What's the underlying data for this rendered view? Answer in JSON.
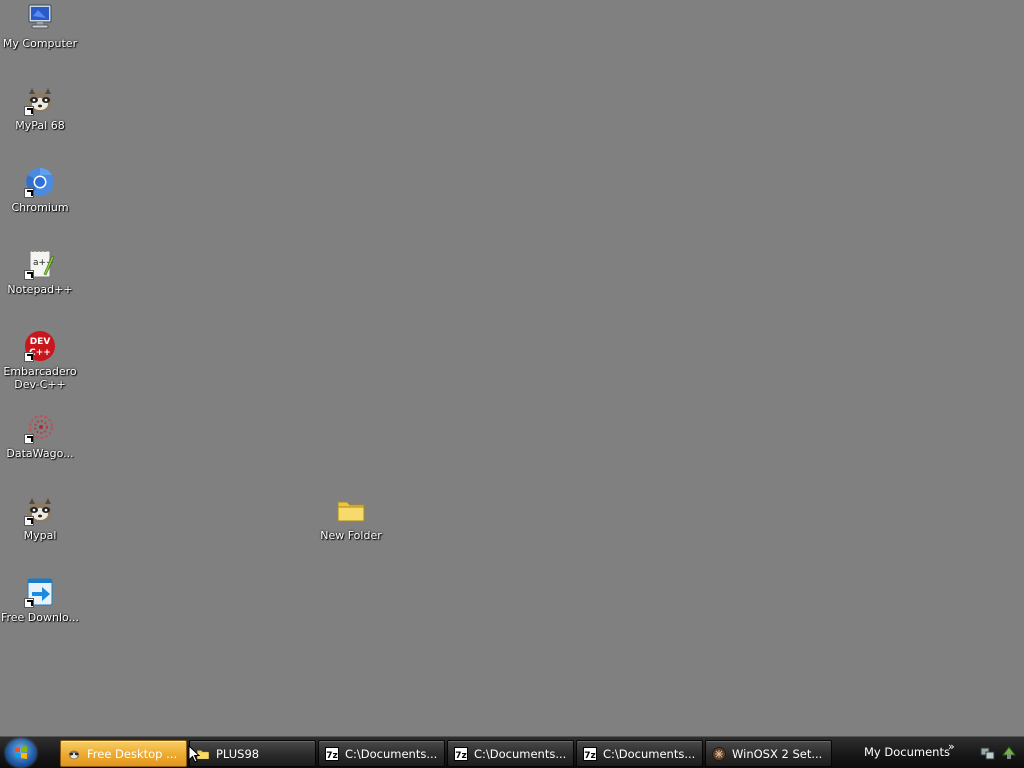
{
  "desktop": {
    "background": "#808080",
    "icons": [
      {
        "label": "My Computer",
        "icon": "computer-icon"
      },
      {
        "label": "MyPal 68",
        "icon": "mypal-icon",
        "shortcut": true
      },
      {
        "label": "Chromium",
        "icon": "chromium-icon",
        "shortcut": true
      },
      {
        "label": "Notepad++",
        "icon": "notepad-plus-plus-icon",
        "shortcut": true
      },
      {
        "label": "Embarcadero Dev-C++",
        "icon": "dev-cpp-icon",
        "shortcut": true
      },
      {
        "label": "DataWago...",
        "icon": "datawagon-icon",
        "shortcut": true
      },
      {
        "label": "Mypal",
        "icon": "mypal-icon",
        "shortcut": true
      },
      {
        "label": "Free Downlo...",
        "icon": "free-download-manager-icon",
        "shortcut": true
      },
      {
        "label": "New Folder",
        "icon": "folder-icon"
      }
    ]
  },
  "taskbar": {
    "buttons": [
      {
        "label": "Free Desktop ...",
        "icon": "mypal-icon",
        "active": true
      },
      {
        "label": "PLUS98",
        "icon": "folder-icon"
      },
      {
        "label": "C:\\Documents...",
        "icon": "7zip-icon"
      },
      {
        "label": "C:\\Documents...",
        "icon": "7zip-icon"
      },
      {
        "label": "C:\\Documents...",
        "icon": "7zip-icon"
      },
      {
        "label": "WinOSX 2 Set...",
        "icon": "winosx-icon"
      }
    ],
    "toolbar_label": "My Documents",
    "chevron": "»"
  },
  "colors": {
    "accent_active": "#eeac32",
    "taskbar": "#1c1c1c"
  }
}
